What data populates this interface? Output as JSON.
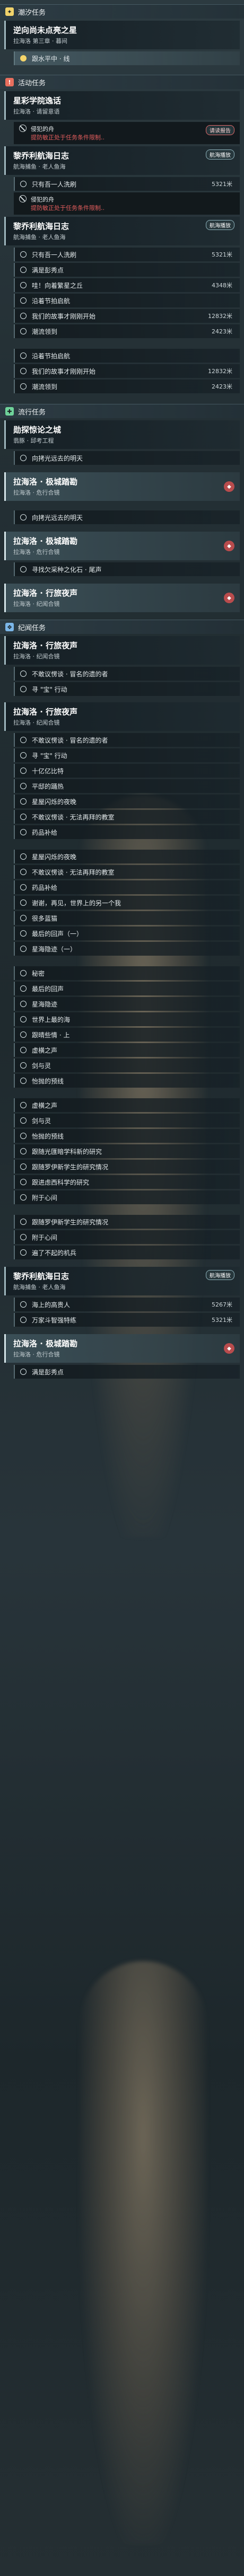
{
  "sections": {
    "tidal": "潮汐任务",
    "event": "活动任务",
    "travel": "流行任务",
    "record": "纪闻任务"
  },
  "badges": {
    "read_journal": "请读报告",
    "ship_log": "航海播放"
  },
  "tasks": [
    {
      "title": "逆向尚未点亮之星",
      "sub": "拉海洛 第三章 · 暮间"
    },
    {
      "title": "星彩学院逸话",
      "sub": "拉海洛 · 请留意语"
    },
    {
      "title": "黎乔利航海日志",
      "sub": "航海捕鱼 · 老人鱼海"
    },
    {
      "title": "星彩学院逸话",
      "sub": "拉海洛 · 请留意语"
    },
    {
      "title": "黎乔利航海日志",
      "sub": "航海捕鱼 · 老人鱼海"
    },
    {
      "title": "勋探惊论之城",
      "sub": "翡豚 · 邱考工程"
    },
    {
      "title": "拉海洛 · 极城踏勘",
      "sub": "拉海洛 · 危行合镜"
    },
    {
      "title": "拉海洛 · 极城踏勘",
      "sub": "拉海洛 · 危行合镜"
    },
    {
      "title": "拉海洛 · 行旅夜声",
      "sub": "拉海洛 · 纪闻合镜"
    },
    {
      "title": "拉海洛 · 行旅夜声",
      "sub": "拉海洛 · 纪闻合镜"
    },
    {
      "title": "黎乔利航海日志",
      "sub": "航海捕鱼 · 老人鱼海"
    },
    {
      "title": "拉海洛 · 极城踏勘",
      "sub": "拉海洛 · 危行合镜"
    }
  ],
  "steps": {
    "follow_star": "跟水平中 · 线",
    "ship_in": "只有吾一人洗刷",
    "trees": "满是彭秀点",
    "wow": "哇！向着繁星之丘",
    "tales": "我们的故事才刚刚开始",
    "festival": "沿着节拍启航",
    "discipline": "潮流领到",
    "lonely": "向拷光远去的明天",
    "search_fossil": "寻找欠采种之化石 · 尾声",
    "not_silver": "不敢议愣谈 · 冒名的遗的者",
    "find_treasure": "寻 \"宝\" 行动",
    "billion": "十亿亿比特",
    "farm_meet": "平邸的踊热",
    "star_night": "星屋闪烁的夜晚",
    "not_visible": "不敢议愣谈 · 无法再拜的教室",
    "medicine": "药品补给",
    "thanks": "谢谢，再见，世界上的另一个我",
    "many_light": "很多蓝猫",
    "eclipse": "最后的回声（一）",
    "fine_moon": "星海隐迹（一）",
    "secret": "秘密",
    "final_eclipse": "最后的回声",
    "fine_moon2": "星海隐迹",
    "world_sea": "世界上最的海",
    "pass_line": "跟晴些情 · 上",
    "darkness": "虚横之声",
    "dance_bright": "剑与灵",
    "ashes": "怡抛的预线",
    "follow_star2": "跟随光匯暗学科新的研究",
    "follow_student": "跟随罗伊新学生的研究情况",
    "vermilion": "跟进虑西科学的研究",
    "friend": "附于心间",
    "not_hot": "遍了不起的机兵",
    "sea_hover": "海上的高贵人",
    "sky_jump": "万家斗智强特练",
    "remain": "满是彭秀点"
  },
  "distances": {
    "d1": "5321米",
    "d2": "4348米",
    "d3": "12832米",
    "d4": "2423米",
    "d5": "12832米",
    "d6": "2423米",
    "d7": "5267米",
    "d8": "5321米"
  },
  "warns": {
    "top": "侵犯的舟",
    "bot": "提防敏正处于任务条件限制.."
  }
}
